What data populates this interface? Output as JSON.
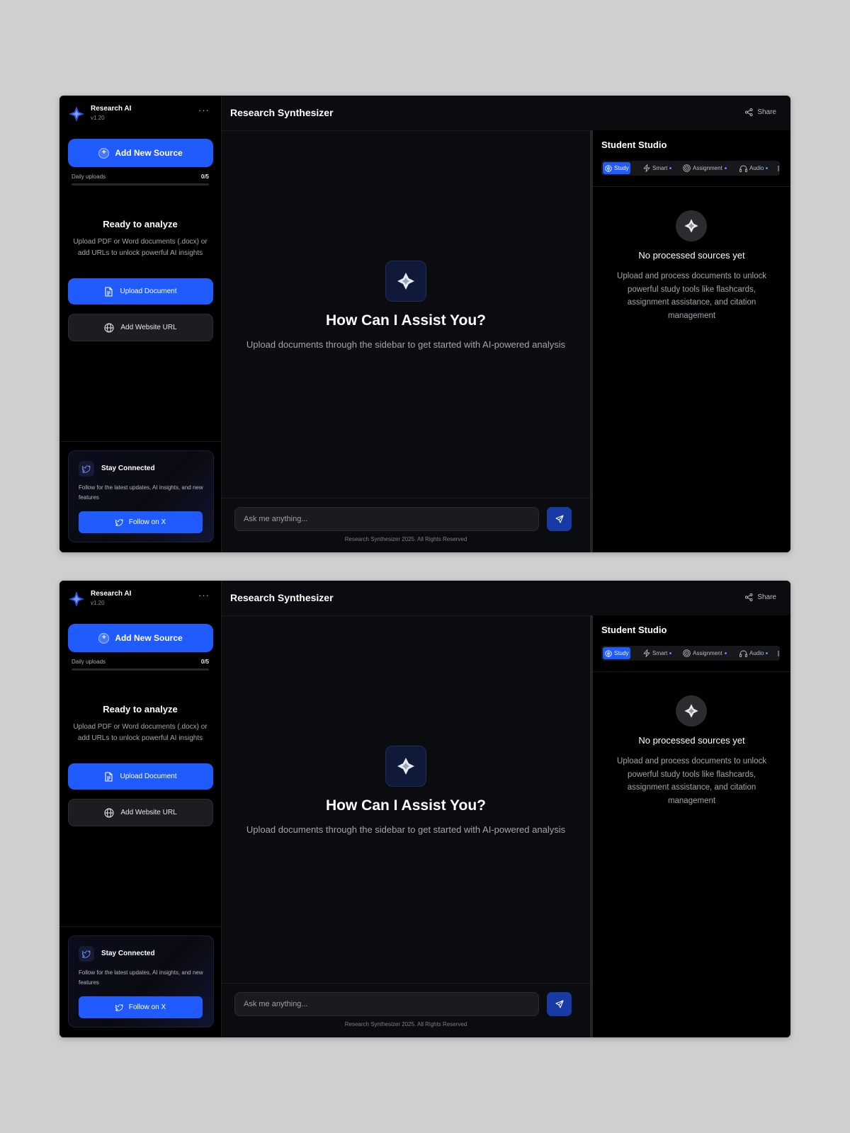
{
  "brand": {
    "name": "Research AI",
    "version": "v1.20",
    "more_label": "···"
  },
  "sidebar": {
    "add_source_label": "Add New Source",
    "add_source_icon": "plus-circle-icon",
    "daily_uploads_label": "Daily uploads",
    "daily_uploads_count": "0/5",
    "daily_uploads_used": 0,
    "daily_uploads_limit": 5,
    "ready_title": "Ready to analyze",
    "ready_desc": "Upload PDF or Word documents (.docx) or add URLs to unlock powerful AI insights",
    "upload_label": "Upload Document",
    "upload_icon": "document-icon",
    "url_label": "Add Website URL",
    "url_icon": "globe-icon",
    "stay": {
      "title": "Stay Connected",
      "desc": "Follow for the latest updates, AI insights, and new features",
      "follow_label": "Follow on X",
      "icon": "bird-icon"
    }
  },
  "header": {
    "title": "Research Synthesizer",
    "share_label": "Share",
    "share_icon": "share-icon"
  },
  "main": {
    "hero_title": "How Can I Assist You?",
    "hero_desc": "Upload documents through the sidebar to get started with AI-powered analysis",
    "input_placeholder": "Ask me anything...",
    "send_icon": "send-icon",
    "footer": "Research Synthesizer 2025. All Rights Reserved"
  },
  "studio": {
    "title": "Student Studio",
    "tabs": [
      {
        "label": "Study",
        "icon": "brain-icon",
        "active": true
      },
      {
        "label": "Smart",
        "icon": "bolt-icon",
        "active": false
      },
      {
        "label": "Assignment",
        "icon": "target-icon",
        "active": false
      },
      {
        "label": "Audio",
        "icon": "headphones-icon",
        "active": false
      }
    ],
    "empty_title": "No processed sources yet",
    "empty_desc": "Upload and process documents to unlock powerful study tools like flashcards, assignment assistance, and citation management"
  },
  "colors": {
    "accent": "#1f5bff",
    "background": "#0b0c0f",
    "sidebar": "#000000",
    "page": "#cfcfcf"
  }
}
